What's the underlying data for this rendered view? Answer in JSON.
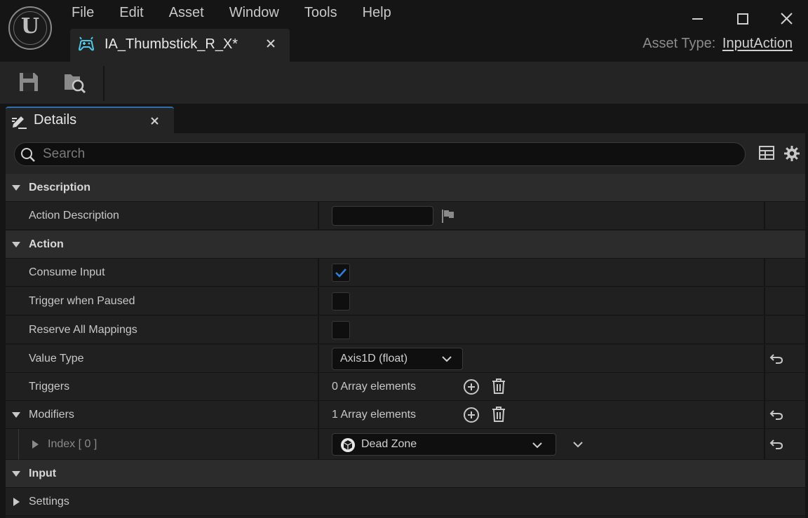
{
  "app": {
    "logo_letter": "U",
    "menu": [
      "File",
      "Edit",
      "Asset",
      "Window",
      "Tools",
      "Help"
    ],
    "document_tab": {
      "label": "IA_Thumbstick_R_X*"
    },
    "asset_type": {
      "label": "Asset Type:",
      "value": "InputAction"
    }
  },
  "toolbar": {
    "buttons": [
      "save-icon",
      "browse-folder-icon"
    ]
  },
  "details": {
    "tab_label": "Details",
    "search": {
      "placeholder": "Search",
      "value": ""
    },
    "categories": {
      "description": "Description",
      "action": "Action",
      "input": "Input"
    },
    "properties": {
      "action_description": {
        "label": "Action Description",
        "value": ""
      },
      "consume_input": {
        "label": "Consume Input",
        "checked": true
      },
      "trigger_when_paused": {
        "label": "Trigger when Paused",
        "checked": false
      },
      "reserve_all_mappings": {
        "label": "Reserve All Mappings",
        "checked": false
      },
      "value_type": {
        "label": "Value Type",
        "value": "Axis1D (float)"
      },
      "triggers": {
        "label": "Triggers",
        "value": "0 Array elements"
      },
      "modifiers": {
        "label": "Modifiers",
        "value": "1 Array elements"
      },
      "modifier_index0": {
        "label": "Index [ 0 ]",
        "value": "Dead Zone"
      },
      "settings": {
        "label": "Settings"
      }
    }
  },
  "colors": {
    "accent_blue": "#2f6ea8",
    "checkmark_blue": "#2e7fd9",
    "background": "#151515",
    "panel": "#242424"
  }
}
